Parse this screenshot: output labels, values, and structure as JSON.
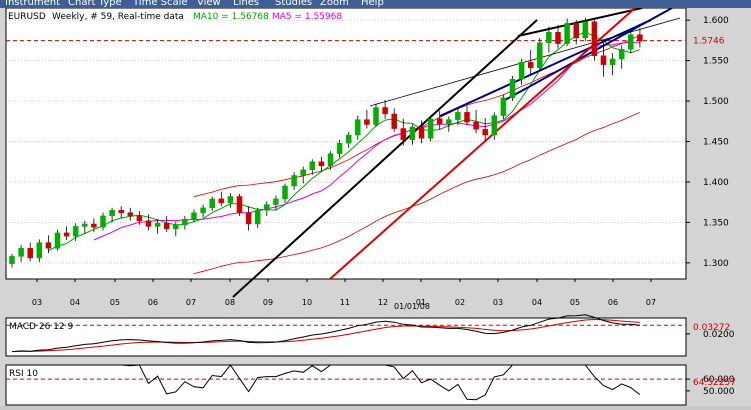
{
  "menu": [
    "Instrument",
    "Chart Type",
    "Time Scale",
    "View",
    "Lines",
    "Studies",
    "Zoom",
    "Help"
  ],
  "colors": {
    "bg": "#ffffff",
    "frame": "#d4d4d4",
    "menubar": "#3d5f96",
    "bull": "#00b000",
    "bear": "#d00000",
    "ma10": "#e000e0",
    "ma5": "#00a000",
    "envelope": "#d00000",
    "trendline_black": "#000000",
    "trendline_red": "#e00000",
    "trendline_navy": "#000080",
    "macd": "#000000",
    "signal": "#d00000",
    "rsi": "#000000",
    "refline": "#d00000"
  },
  "header": {
    "symbol": "EURUSD",
    "details": "Weekly, # 59, Real-time data",
    "ma10_label": "MA10 = 1.56768",
    "ma5_label": "MA5 = 1.55968"
  },
  "price_label": "1.5746",
  "date_label": "01/01/08",
  "macd_title": "MACD 26 12 9",
  "macd_value_label": "0.03272",
  "rsi_title": "RSI 10",
  "rsi_value_label": "64.52257",
  "chart_data": {
    "type": "candlestick",
    "title": "EURUSD , Weekly, # 59, Real-time data",
    "price_axis": {
      "ylim": [
        1.28,
        1.615
      ],
      "ticks": [
        "1.300",
        "1.350",
        "1.400",
        "1.450",
        "1.500",
        "1.550",
        "1.600"
      ]
    },
    "x_ticks": [
      "03",
      "04",
      "05",
      "06",
      "07",
      "08",
      "09",
      "10",
      "11",
      "12",
      "01",
      "02",
      "03",
      "04",
      "05",
      "06",
      "07"
    ],
    "date_label": "01/01/08",
    "current_price": 1.5746,
    "candles": [
      [
        1.299,
        1.311,
        1.294,
        1.308
      ],
      [
        1.308,
        1.322,
        1.301,
        1.318
      ],
      [
        1.318,
        1.325,
        1.302,
        1.306
      ],
      [
        1.306,
        1.329,
        1.301,
        1.325
      ],
      [
        1.325,
        1.334,
        1.312,
        1.318
      ],
      [
        1.318,
        1.341,
        1.315,
        1.337
      ],
      [
        1.337,
        1.345,
        1.328,
        1.333
      ],
      [
        1.333,
        1.349,
        1.327,
        1.345
      ],
      [
        1.345,
        1.352,
        1.336,
        1.348
      ],
      [
        1.348,
        1.355,
        1.338,
        1.344
      ],
      [
        1.344,
        1.362,
        1.34,
        1.358
      ],
      [
        1.358,
        1.368,
        1.35,
        1.365
      ],
      [
        1.365,
        1.37,
        1.355,
        1.362
      ],
      [
        1.362,
        1.368,
        1.352,
        1.358
      ],
      [
        1.358,
        1.364,
        1.347,
        1.352
      ],
      [
        1.352,
        1.36,
        1.34,
        1.345
      ],
      [
        1.345,
        1.354,
        1.336,
        1.349
      ],
      [
        1.349,
        1.358,
        1.338,
        1.342
      ],
      [
        1.342,
        1.351,
        1.333,
        1.347
      ],
      [
        1.347,
        1.358,
        1.341,
        1.354
      ],
      [
        1.354,
        1.366,
        1.35,
        1.362
      ],
      [
        1.362,
        1.372,
        1.356,
        1.368
      ],
      [
        1.368,
        1.382,
        1.364,
        1.379
      ],
      [
        1.379,
        1.388,
        1.37,
        1.374
      ],
      [
        1.374,
        1.386,
        1.368,
        1.382
      ],
      [
        1.382,
        1.385,
        1.358,
        1.362
      ],
      [
        1.362,
        1.37,
        1.34,
        1.348
      ],
      [
        1.348,
        1.368,
        1.343,
        1.365
      ],
      [
        1.365,
        1.376,
        1.358,
        1.372
      ],
      [
        1.372,
        1.383,
        1.365,
        1.379
      ],
      [
        1.379,
        1.398,
        1.374,
        1.395
      ],
      [
        1.395,
        1.412,
        1.39,
        1.408
      ],
      [
        1.408,
        1.419,
        1.398,
        1.415
      ],
      [
        1.415,
        1.428,
        1.409,
        1.425
      ],
      [
        1.425,
        1.431,
        1.413,
        1.42
      ],
      [
        1.42,
        1.438,
        1.415,
        1.435
      ],
      [
        1.435,
        1.452,
        1.43,
        1.448
      ],
      [
        1.448,
        1.462,
        1.442,
        1.458
      ],
      [
        1.458,
        1.482,
        1.452,
        1.477
      ],
      [
        1.477,
        1.489,
        1.466,
        1.471
      ],
      [
        1.471,
        1.497,
        1.468,
        1.492
      ],
      [
        1.492,
        1.501,
        1.478,
        1.484
      ],
      [
        1.484,
        1.491,
        1.462,
        1.466
      ],
      [
        1.466,
        1.478,
        1.445,
        1.452
      ],
      [
        1.452,
        1.471,
        1.446,
        1.468
      ],
      [
        1.468,
        1.476,
        1.448,
        1.454
      ],
      [
        1.454,
        1.482,
        1.45,
        1.478
      ],
      [
        1.478,
        1.488,
        1.465,
        1.472
      ],
      [
        1.472,
        1.481,
        1.462,
        1.477
      ],
      [
        1.477,
        1.491,
        1.47,
        1.486
      ],
      [
        1.486,
        1.494,
        1.47,
        1.474
      ],
      [
        1.474,
        1.489,
        1.46,
        1.465
      ],
      [
        1.465,
        1.479,
        1.451,
        1.458
      ],
      [
        1.458,
        1.486,
        1.452,
        1.482
      ],
      [
        1.482,
        1.508,
        1.478,
        1.504
      ],
      [
        1.504,
        1.531,
        1.5,
        1.527
      ],
      [
        1.527,
        1.552,
        1.52,
        1.548
      ],
      [
        1.548,
        1.563,
        1.532,
        1.541
      ],
      [
        1.541,
        1.578,
        1.538,
        1.572
      ],
      [
        1.572,
        1.592,
        1.56,
        1.585
      ],
      [
        1.585,
        1.594,
        1.565,
        1.571
      ],
      [
        1.571,
        1.602,
        1.568,
        1.596
      ],
      [
        1.596,
        1.6,
        1.57,
        1.578
      ],
      [
        1.578,
        1.603,
        1.574,
        1.598
      ],
      [
        1.598,
        1.6,
        1.55,
        1.556
      ],
      [
        1.556,
        1.572,
        1.53,
        1.545
      ],
      [
        1.545,
        1.559,
        1.532,
        1.552
      ],
      [
        1.552,
        1.569,
        1.54,
        1.564
      ],
      [
        1.564,
        1.589,
        1.559,
        1.582
      ],
      [
        1.582,
        1.59,
        1.566,
        1.574
      ]
    ],
    "macd_axis": {
      "ylim": [
        -0.005,
        0.038
      ],
      "ticks": [
        "0.0200"
      ]
    },
    "rsi_axis": {
      "ylim": [
        38,
        72
      ],
      "ticks": [
        "60.000",
        "50.000"
      ]
    },
    "rsi_reference": 60
  }
}
